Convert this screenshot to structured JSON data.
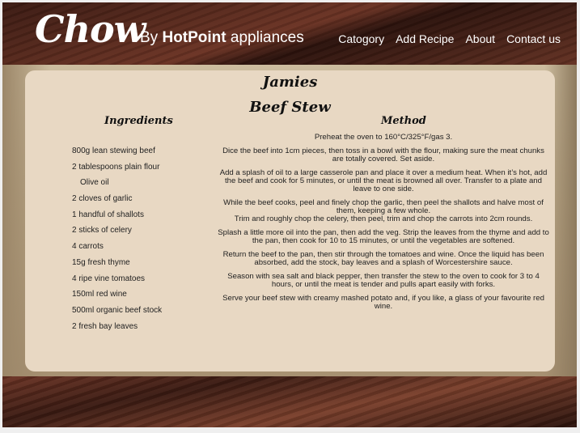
{
  "header": {
    "logo": "Chow",
    "by": "By",
    "brand": "HotPoint",
    "brand_suffix": "appliances",
    "nav": [
      "Catogory",
      "Add Recipe",
      "About",
      "Contact us"
    ]
  },
  "recipe": {
    "title_line1": "Jamies",
    "title_line2": "Beef Stew",
    "ingredients_heading": "Ingredients",
    "method_heading": "Method",
    "ingredients": [
      "800g lean stewing beef",
      "2  tablespoons plain flour",
      "Olive oil",
      "2  cloves of garlic",
      "1  handful of shallots",
      "2  sticks of celery",
      "4  carrots",
      "15g  fresh thyme",
      "4  ripe vine tomatoes",
      "150ml  red wine",
      "500ml  organic beef stock",
      "2  fresh bay leaves"
    ],
    "method": [
      "Preheat the oven to 160°C/325°F/gas 3.",
      "Dice the beef into 1cm pieces, then toss in a bowl with the flour, making sure the meat chunks are totally covered. Set aside.",
      "Add a splash of oil to a large casserole pan and place it over a medium heat. When it’s hot, add the beef and cook for 5 minutes, or until the meat is browned all over. Transfer to a plate and leave to one side.",
      "While the beef cooks, peel and finely chop the garlic, then peel the shallots and halve most of them, keeping a few whole.",
      "Trim and roughly chop the celery, then peel, trim and chop the carrots into 2cm rounds.",
      "Splash a little more oil into the pan, then add the veg. Strip the leaves from the thyme and add to the pan, then cook for 10 to 15 minutes, or until the vegetables are softened.",
      "Return the beef to the pan, then stir through the tomatoes and wine. Once the liquid has been absorbed, add the stock, bay leaves and a splash of Worcestershire sauce.",
      "Season with sea salt and black pepper, then transfer the stew to the oven to cook for 3 to 4 hours, or until the meat is tender and pulls apart easily with forks.",
      "Serve your beef stew with creamy mashed potato and, if you like, a glass of your favourite red wine."
    ]
  }
}
